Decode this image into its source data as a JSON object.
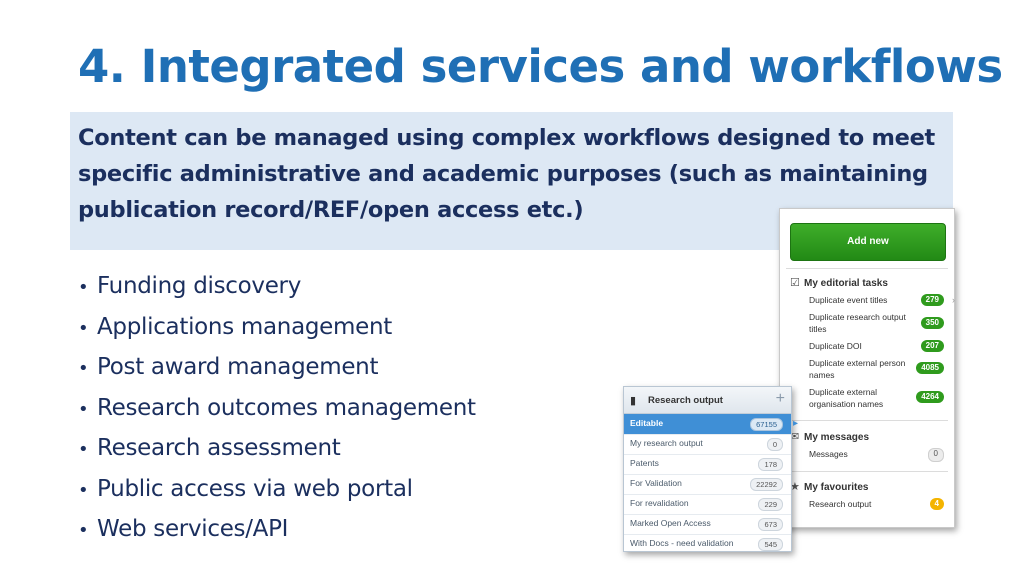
{
  "slide": {
    "title": "4. Integrated services and workflows",
    "callout": "Content can be managed using complex workflows designed to meet specific administrative and academic purposes (such as maintaining publication record/REF/open access etc.)",
    "bullet_char": "•",
    "bullets": [
      "Funding discovery",
      "Applications management",
      "Post award management",
      "Research outcomes management",
      "Research assessment",
      "Public access via web portal",
      "Web services/API"
    ]
  },
  "editorial_panel": {
    "add_new_label": "Add new",
    "tasks_heading": "My editorial tasks",
    "tasks": [
      {
        "label": "Duplicate event titles",
        "count": "279"
      },
      {
        "label": "Duplicate research output titles",
        "count": "350"
      },
      {
        "label": "Duplicate DOI",
        "count": "207"
      },
      {
        "label": "Duplicate external person names",
        "count": "4085"
      },
      {
        "label": "Duplicate external organisation names",
        "count": "4264"
      }
    ],
    "messages_heading": "My messages",
    "messages_label": "Messages",
    "messages_count": "0",
    "favourites_heading": "My favourites",
    "favourites_label": "Research output",
    "favourites_count": "4",
    "colors": {
      "badge_green": "#2f9b1d",
      "badge_amber": "#f4b400",
      "button_green": "#2f9b1d"
    }
  },
  "research_panel": {
    "heading": "Research output",
    "rows": [
      {
        "label": "Editable",
        "count": "67155"
      },
      {
        "label": "My research output",
        "count": "0"
      },
      {
        "label": "Patents",
        "count": "178"
      },
      {
        "label": "For Validation",
        "count": "22292"
      },
      {
        "label": "For revalidation",
        "count": "229"
      },
      {
        "label": "Marked Open Access",
        "count": "673"
      },
      {
        "label": "With Docs - need validation",
        "count": "545"
      }
    ],
    "colors": {
      "active_row": "#3f8fd6"
    }
  }
}
